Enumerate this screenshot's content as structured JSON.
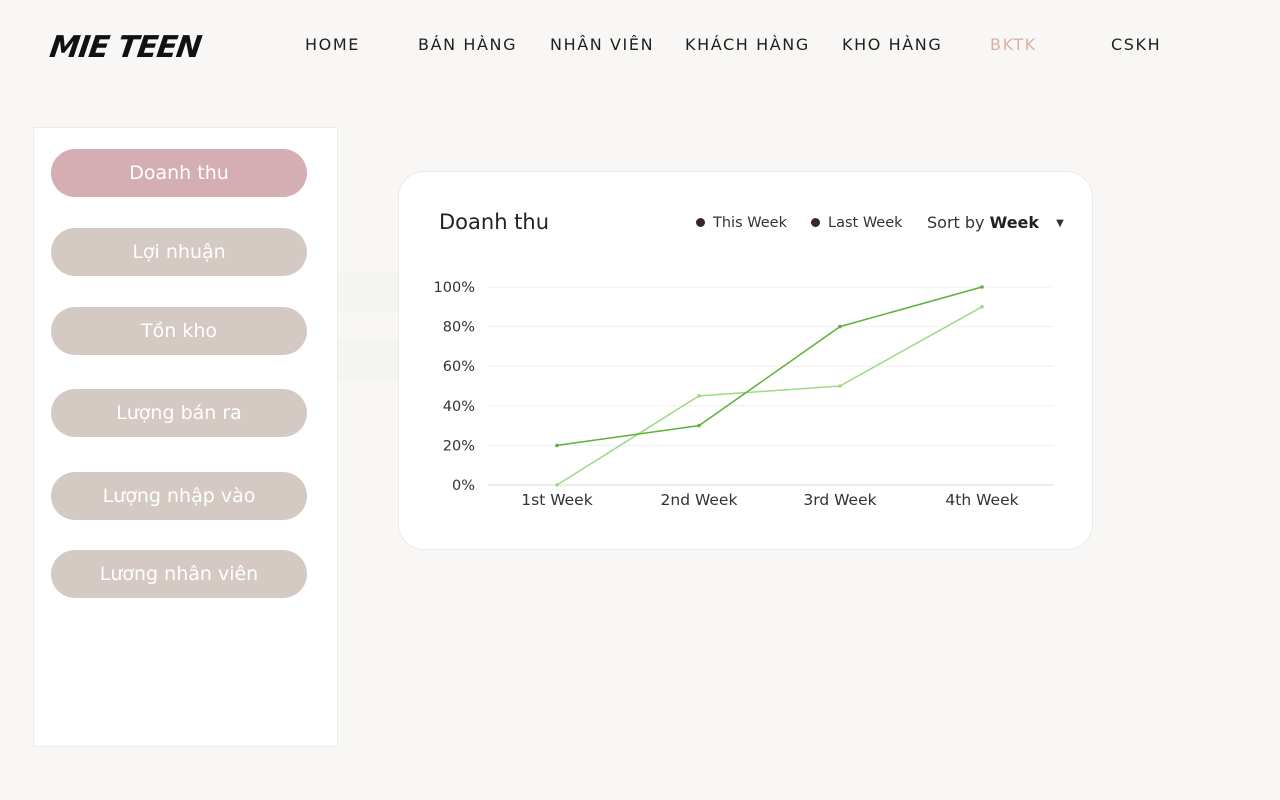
{
  "brand": {
    "logo": "MIE TEEN"
  },
  "nav": {
    "items": [
      {
        "label": "HOME"
      },
      {
        "label": "BÁN HÀNG"
      },
      {
        "label": "NHÂN VIÊN"
      },
      {
        "label": "KHÁCH HÀNG"
      },
      {
        "label": "KHO HÀNG"
      },
      {
        "label": "BKTK"
      },
      {
        "label": "CSKH"
      }
    ],
    "active": "BKTK",
    "active_color": "#d9b2a6"
  },
  "sidebar": {
    "items": [
      {
        "label": "Doanh thu"
      },
      {
        "label": "Lợi nhuận"
      },
      {
        "label": "Tồn kho"
      },
      {
        "label": "Lượng bán ra"
      },
      {
        "label": "Lượng nhập vào"
      },
      {
        "label": "Lương nhân viên"
      }
    ],
    "active": "Doanh thu",
    "active_color": "#d4aeb3",
    "inactive_color": "#d4c9c3"
  },
  "card": {
    "title": "Doanh thu",
    "legend": [
      {
        "label": "This Week"
      },
      {
        "label": "Last Week"
      }
    ],
    "sort": {
      "prefix": "Sort by",
      "value": "Week"
    }
  },
  "chart_data": {
    "type": "line",
    "categories": [
      "1st Week",
      "2nd Week",
      "3rd Week",
      "4th Week"
    ],
    "series": [
      {
        "name": "This Week",
        "values": [
          20,
          30,
          80,
          100
        ],
        "color": "#5fb03a"
      },
      {
        "name": "Last Week",
        "values": [
          0,
          45,
          50,
          90
        ],
        "color": "#9ed98a"
      }
    ],
    "yticks": [
      "0%",
      "20%",
      "40%",
      "60%",
      "80%",
      "100%"
    ],
    "ylim": [
      0,
      100
    ],
    "grid": true,
    "legend_position": "top-right"
  }
}
